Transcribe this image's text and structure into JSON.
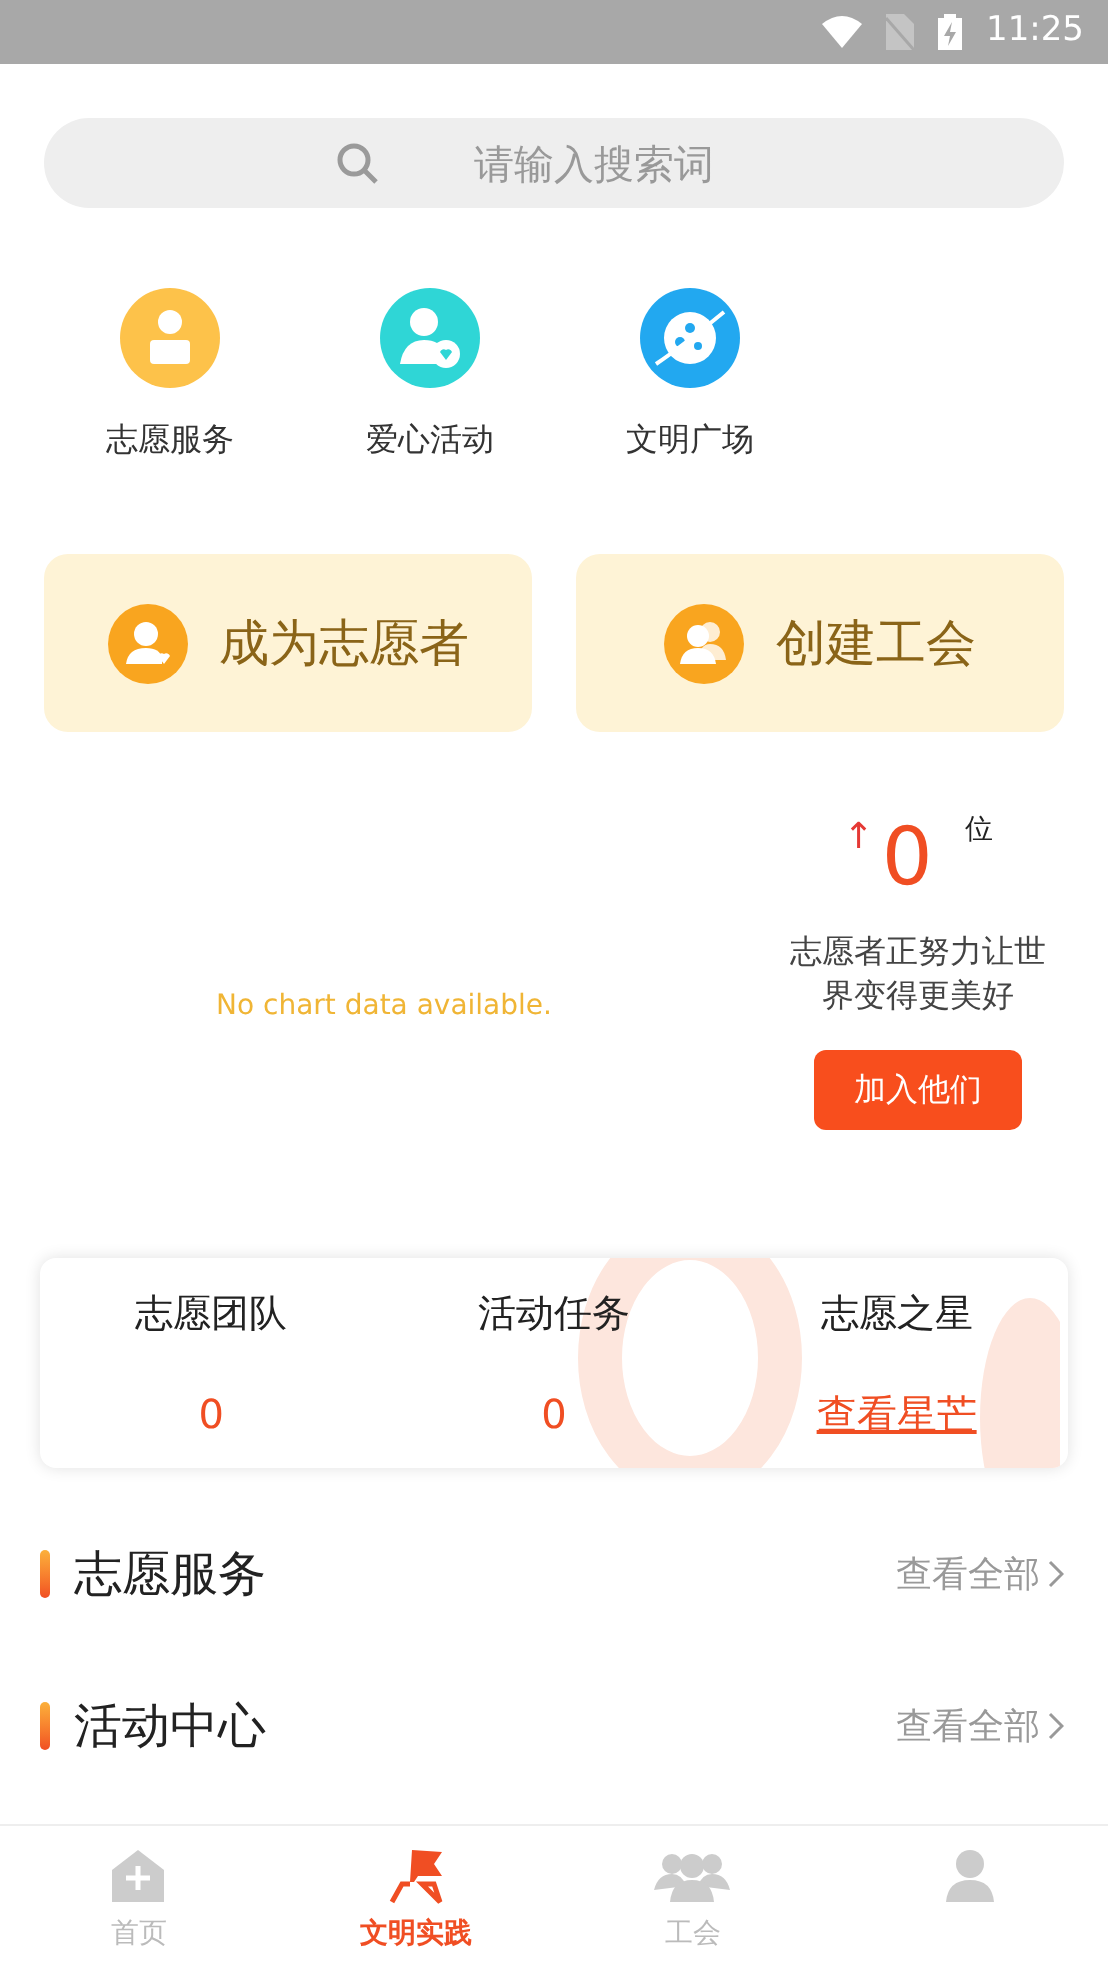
{
  "status_bar": {
    "time": "11:25"
  },
  "search": {
    "placeholder": "请输入搜索词"
  },
  "shortcuts": [
    {
      "label": "志愿服务",
      "kind": "volunteer"
    },
    {
      "label": "爱心活动",
      "kind": "love"
    },
    {
      "label": "文明广场",
      "kind": "planet"
    }
  ],
  "action_cards": [
    {
      "label": "成为志愿者",
      "kind": "person"
    },
    {
      "label": "创建工会",
      "kind": "group"
    }
  ],
  "ranking": {
    "empty_message": "No chart data available.",
    "arrow": "↑",
    "rank": "0",
    "unit": "位",
    "slogan": "志愿者正努力让世界变得更美好",
    "button": "加入他们"
  },
  "stats": [
    {
      "label": "志愿团队",
      "value": "0",
      "kind": "number"
    },
    {
      "label": "活动任务",
      "value": "0",
      "kind": "number"
    },
    {
      "label": "志愿之星",
      "value": "查看星芒",
      "kind": "link"
    }
  ],
  "sections": [
    {
      "title": "志愿服务",
      "more": "查看全部"
    },
    {
      "title": "活动中心",
      "more": "查看全部"
    }
  ],
  "tabs": [
    {
      "label": "首页",
      "selected": false,
      "kind": "home"
    },
    {
      "label": "文明实践",
      "selected": true,
      "kind": "flag"
    },
    {
      "label": "工会",
      "selected": false,
      "kind": "group"
    },
    {
      "selected": false,
      "kind": "person"
    }
  ]
}
